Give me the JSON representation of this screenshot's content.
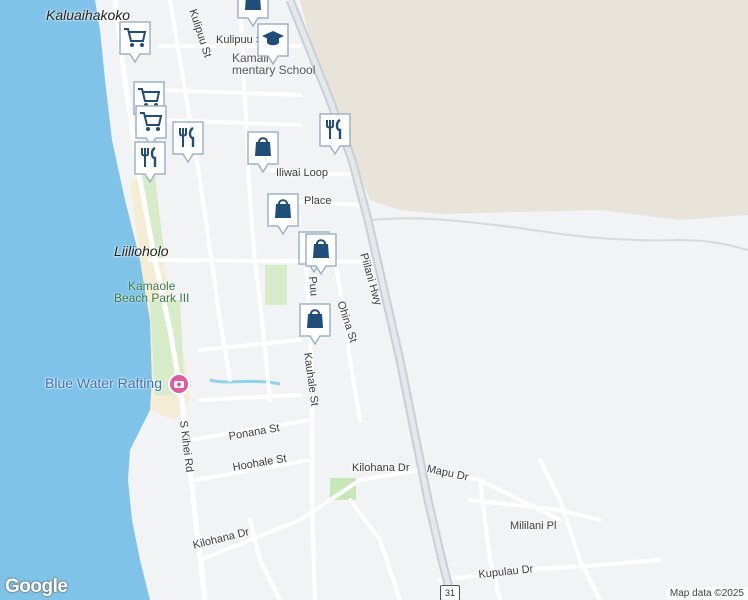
{
  "map": {
    "place_labels": {
      "kaluaihakoko": "Kaluaihakoko",
      "liliholo": "Liilioholo"
    },
    "school_label": "Kamaliʻi Elementary School",
    "school_label_visible": "Kamali",
    "school_label_line2": "mentary School",
    "park_label_line1": "Kamaole",
    "park_label_line2": "Beach Park III",
    "poi_label": "Blue Water Rafting",
    "roads": {
      "kulipuu": "Kulipuu St",
      "kulipuu_vertical": "Kulipuu St",
      "iliwai": "Iliwai Loop",
      "place": "Place",
      "piilani": "Piilani Hwy",
      "puu": "Puu",
      "ohina": "Ohina St",
      "kauhale": "Kauhale St",
      "kihei": "S Kihei Rd",
      "ponana": "Ponana St",
      "hoohale": "Hoohale St",
      "kilohana_east": "Kilohana Dr",
      "kilohana_west": "Kilohana Dr",
      "mapu": "Mapu Dr",
      "mililani": "Mililani Pl",
      "kupulau": "Kupulau Dr"
    },
    "route_shield": "31",
    "google_logo": "Google",
    "attribution": "Map data ©2025"
  },
  "markers": [
    {
      "type": "shopping-icon",
      "label": ""
    },
    {
      "type": "education-icon",
      "label": ""
    },
    {
      "type": "grocery-cart-icon",
      "label": ""
    },
    {
      "type": "grocery-cart-icon",
      "label": ""
    },
    {
      "type": "grocery-cart-icon",
      "label": ""
    },
    {
      "type": "restaurant-icon",
      "label": ""
    },
    {
      "type": "restaurant-icon",
      "label": ""
    },
    {
      "type": "restaurant-icon",
      "label": ""
    },
    {
      "type": "shopping-icon",
      "label": ""
    },
    {
      "type": "shopping-icon",
      "label": ""
    },
    {
      "type": "shopping-icon",
      "label": ""
    },
    {
      "type": "shopping-icon",
      "label": ""
    },
    {
      "type": "shopping-icon",
      "label": ""
    }
  ],
  "colors": {
    "ocean": "#7fc4e8",
    "land": "#f2f3f5",
    "mountain": "#e8e4d9",
    "park": "#d6ecc9",
    "marker_fill": "#1f4e7a",
    "road": "#ffffff",
    "highway": "#c9cfd6"
  }
}
